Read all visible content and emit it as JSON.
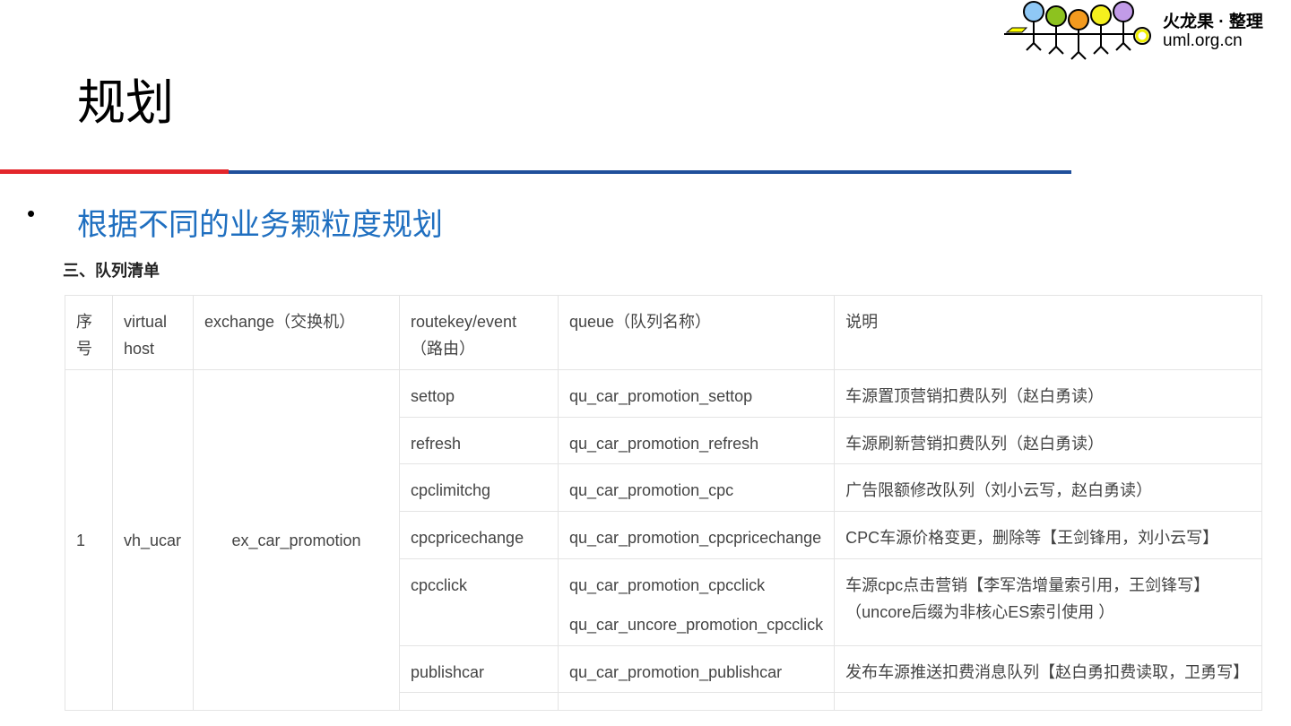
{
  "logo": {
    "title": "火龙果 · 整理",
    "url": "uml.org.cn"
  },
  "page_title": "规划",
  "bullet": {
    "symbol": "•",
    "text": "根据不同的业务颗粒度规划"
  },
  "section_title": "三、队列清单",
  "table": {
    "headers": [
      "序号",
      "virtual host",
      "exchange（交换机）",
      "routekey/event（路由）",
      "queue（队列名称）",
      "说明"
    ],
    "group": {
      "index": "1",
      "vhost": "vh_ucar",
      "exchange": "ex_car_promotion"
    },
    "rows": [
      {
        "routekey": "settop",
        "queue": "qu_car_promotion_settop",
        "desc": "车源置顶营销扣费队列（赵白勇读）"
      },
      {
        "routekey": "refresh",
        "queue": "qu_car_promotion_refresh",
        "desc": "车源刷新营销扣费队列（赵白勇读）"
      },
      {
        "routekey": "cpclimitchg",
        "queue": "qu_car_promotion_cpc",
        "desc": "广告限额修改队列（刘小云写，赵白勇读）"
      },
      {
        "routekey": "cpcpricechange",
        "queue": "qu_car_promotion_cpcpricechange",
        "desc": "CPC车源价格变更，删除等【王剑锋用，刘小云写】"
      },
      {
        "routekey": "cpcclick",
        "queue": "qu_car_promotion_cpcclick",
        "queue2": "qu_car_uncore_promotion_cpcclick",
        "desc": "车源cpc点击营销【李军浩增量索引用，王剑锋写】",
        "desc2": "（uncore后缀为非核心ES索引使用 ）"
      },
      {
        "routekey": "publishcar",
        "queue": "qu_car_promotion_publishcar",
        "desc": "发布车源推送扣费消息队列【赵白勇扣费读取，卫勇写】"
      }
    ]
  }
}
